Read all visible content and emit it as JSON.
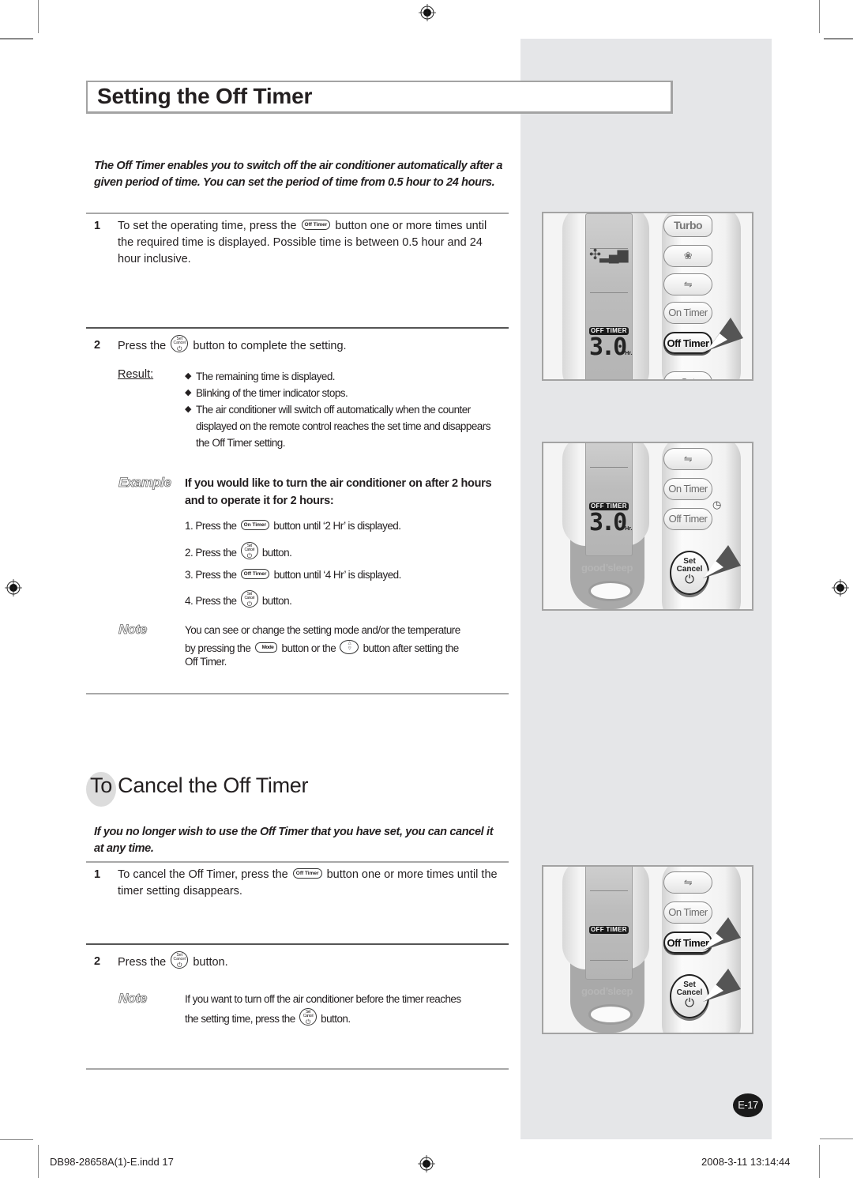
{
  "section1": {
    "title": "Setting the Off Timer",
    "intro": "The Off Timer enables you to switch off the air conditioner automatically after a given period of time. You can set the period of time from 0.5 hour to 24 hours.",
    "step1": {
      "num": "1",
      "text_before": "To set the operating time, press the",
      "button": "Off Timer",
      "text_after": "button one or more times until the required time is displayed. Possible time is between 0.5 hour and 24 hour inclusive."
    },
    "step2": {
      "num": "2",
      "text_before": "Press the",
      "button_top": "Set",
      "button_mid": "Cancel",
      "text_after": "button to complete the setting."
    },
    "result": {
      "label": "Result:",
      "bullets": [
        "The remaining time is displayed.",
        "Blinking of the timer indicator stops.",
        "The air conditioner will switch off automatically when the counter displayed on the remote control reaches the set time and disappears the Off Timer setting."
      ]
    },
    "example": {
      "label": "Example",
      "heading": "If you would like to turn the air conditioner on after 2 hours and to operate it for 2 hours:",
      "steps": [
        {
          "prefix": "1. Press the",
          "button": "On Timer",
          "suffix": "button until ‘2 Hr’ is displayed."
        },
        {
          "prefix": "2. Press the",
          "button": "Set/Cancel",
          "suffix": "button."
        },
        {
          "prefix": "3. Press the",
          "button": "Off Timer",
          "suffix": "button until ‘4 Hr’ is displayed."
        },
        {
          "prefix": "4. Press the",
          "button": "Set/Cancel",
          "suffix": "button."
        }
      ]
    },
    "note": {
      "label": "Note",
      "line1": "You can see or change the setting mode and/or the temperature",
      "line2_prefix": "by pressing the",
      "mode_button": "Mode",
      "line2_mid": "button or the",
      "line2_suffix": "button after setting the",
      "line3": "Off Timer."
    }
  },
  "section2": {
    "title": "To Cancel the Off Timer",
    "intro": "If you no longer wish to use the Off Timer that you have set, you can cancel it at any time.",
    "step1": {
      "num": "1",
      "text_before": "To cancel the Off Timer, press the",
      "button": "Off Timer",
      "text_after": "button one or more times until the timer setting disappears."
    },
    "step2": {
      "num": "2",
      "text_before": "Press the",
      "text_after": "button."
    },
    "note": {
      "label": "Note",
      "line1": "If you want to turn off the air conditioner before the timer reaches",
      "line2_prefix": "the setting time, press the",
      "line2_suffix": "button."
    }
  },
  "remotes": [
    {
      "lcd_label": "OFF TIMER",
      "lcd_value": "3.0",
      "lcd_unit": "Hr.",
      "buttons": [
        "Turbo",
        "",
        "",
        "On Timer",
        "Off Timer"
      ],
      "active_button": "Off Timer"
    },
    {
      "lcd_label": "OFF TIMER",
      "lcd_value": "3.0",
      "lcd_unit": "Hr.",
      "buttons": [
        "",
        "On Timer",
        "Off Timer"
      ],
      "set_top": "Set",
      "set_mid": "Cancel",
      "brand": "good’sleep"
    },
    {
      "lcd_label": "OFF TIMER",
      "buttons": [
        "",
        "On Timer",
        "Off Timer"
      ],
      "active_button": "Off Timer",
      "set_top": "Set",
      "set_mid": "Cancel",
      "brand": "good’sleep"
    }
  ],
  "icons": {
    "button_power": "⏻",
    "fan_level": "fan-speed-icon",
    "swing": "swing-icon",
    "clock": "clock-icon",
    "temp_up": "△",
    "temp_down": "▽"
  },
  "page_number": "E-17",
  "footer": {
    "file": "DB98-28658A(1)-E.indd   17",
    "timestamp": "2008-3-11   13:14:44"
  }
}
